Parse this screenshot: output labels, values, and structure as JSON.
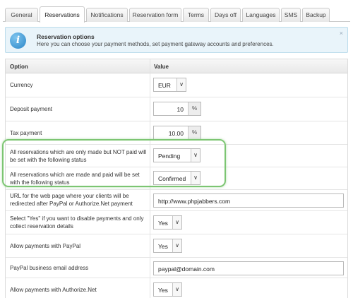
{
  "tabs": [
    {
      "label": "General",
      "active": false
    },
    {
      "label": "Reservations",
      "active": true
    },
    {
      "label": "Notifications",
      "active": false
    },
    {
      "label": "Reservation form",
      "active": false
    },
    {
      "label": "Terms",
      "active": false
    },
    {
      "label": "Days off",
      "active": false
    },
    {
      "label": "Languages",
      "active": false
    },
    {
      "label": "SMS",
      "active": false
    },
    {
      "label": "Backup",
      "active": false
    }
  ],
  "notice": {
    "title": "Reservation options",
    "description": "Here you can choose your payment methods, set payment gateway accounts and preferences.",
    "close": "×"
  },
  "table": {
    "col_option": "Option",
    "col_value": "Value",
    "rows": [
      {
        "label": "Currency",
        "type": "select",
        "value": "EUR"
      },
      {
        "label": "Deposit payment",
        "type": "number",
        "value": "10",
        "unit": "%"
      },
      {
        "label": "Tax payment",
        "type": "number",
        "value": "10.00",
        "unit": "%"
      },
      {
        "label": "All reservations which are only made but NOT paid will be set with the following status",
        "type": "select",
        "value": "Pending"
      },
      {
        "label": "All reservations which are made and paid will be set with the following status",
        "type": "select",
        "value": "Confirmed"
      },
      {
        "label": "URL for the web page where your clients will be redirected after PayPal or Authorize.Net payment",
        "type": "text",
        "value": "http://www.phpjabbers.com"
      },
      {
        "label": "Select \"Yes\" if you want to disable payments and only collect reservation details",
        "type": "select",
        "value": "Yes"
      },
      {
        "label": "Allow payments with PayPal",
        "type": "select",
        "value": "Yes"
      },
      {
        "label": "PayPal business email address",
        "type": "text",
        "value": "paypal@domain.com"
      },
      {
        "label": "Allow payments with Authorize.Net",
        "type": "select",
        "value": "Yes"
      }
    ]
  },
  "icons": {
    "dropdown": "chevron-down-icon",
    "info": "info-icon"
  },
  "colors": {
    "notice_bg": "#e9f4fa",
    "highlight": "#7cc572",
    "info_icon": "#2a86c8"
  }
}
